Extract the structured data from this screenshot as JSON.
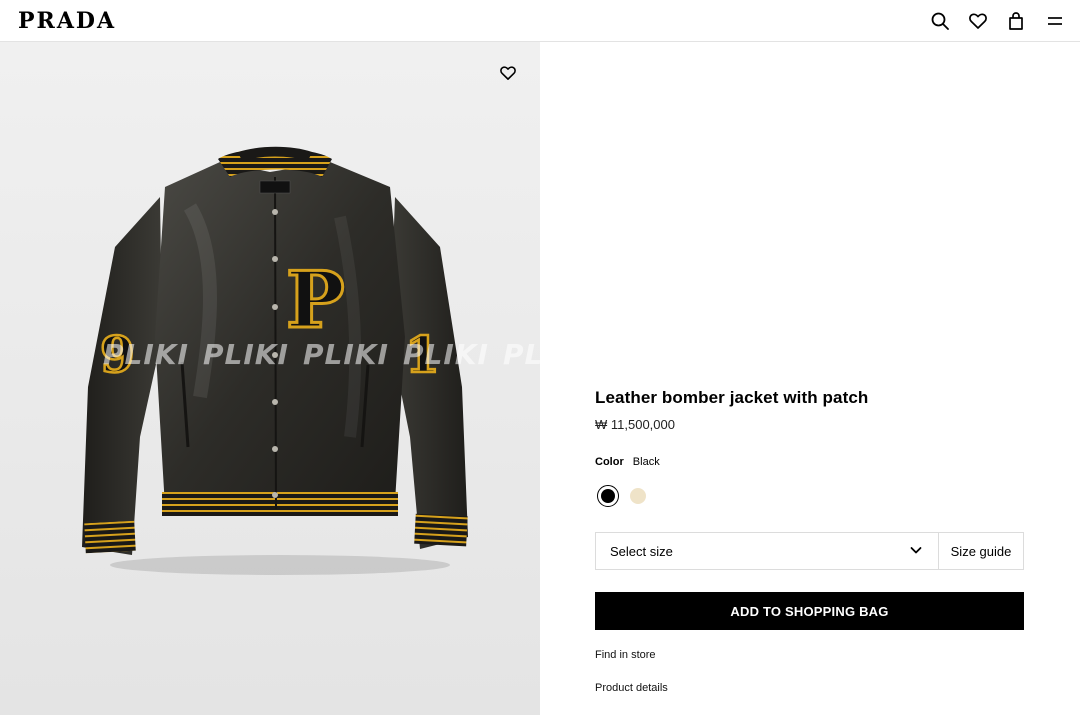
{
  "header": {
    "logo": "PRADA",
    "icons": [
      "search-icon",
      "heart-icon",
      "bag-icon",
      "menu-icon"
    ]
  },
  "image": {
    "alt": "Leather bomber jacket with patch",
    "watermark_text": "PLIKI",
    "wishlist_icon": "heart-icon"
  },
  "product": {
    "title": "Leather bomber jacket with patch",
    "price": "₩ 11,500,000",
    "color_label": "Color",
    "color_value": "Black",
    "swatches": [
      {
        "name": "Black",
        "hex": "#000000",
        "selected": true
      },
      {
        "name": "Cream",
        "hex": "#efe3c8",
        "selected": false
      }
    ],
    "size_placeholder": "Select size",
    "size_guide_label": "Size guide",
    "add_to_bag_label": "ADD TO SHOPPING BAG",
    "find_in_store_label": "Find in store",
    "product_details_label": "Product details"
  },
  "colors": {
    "accent": "#000000",
    "jacket_leather": "#2b2b28",
    "jacket_trim": "#d6a11c",
    "background_panel": "#ececec"
  }
}
